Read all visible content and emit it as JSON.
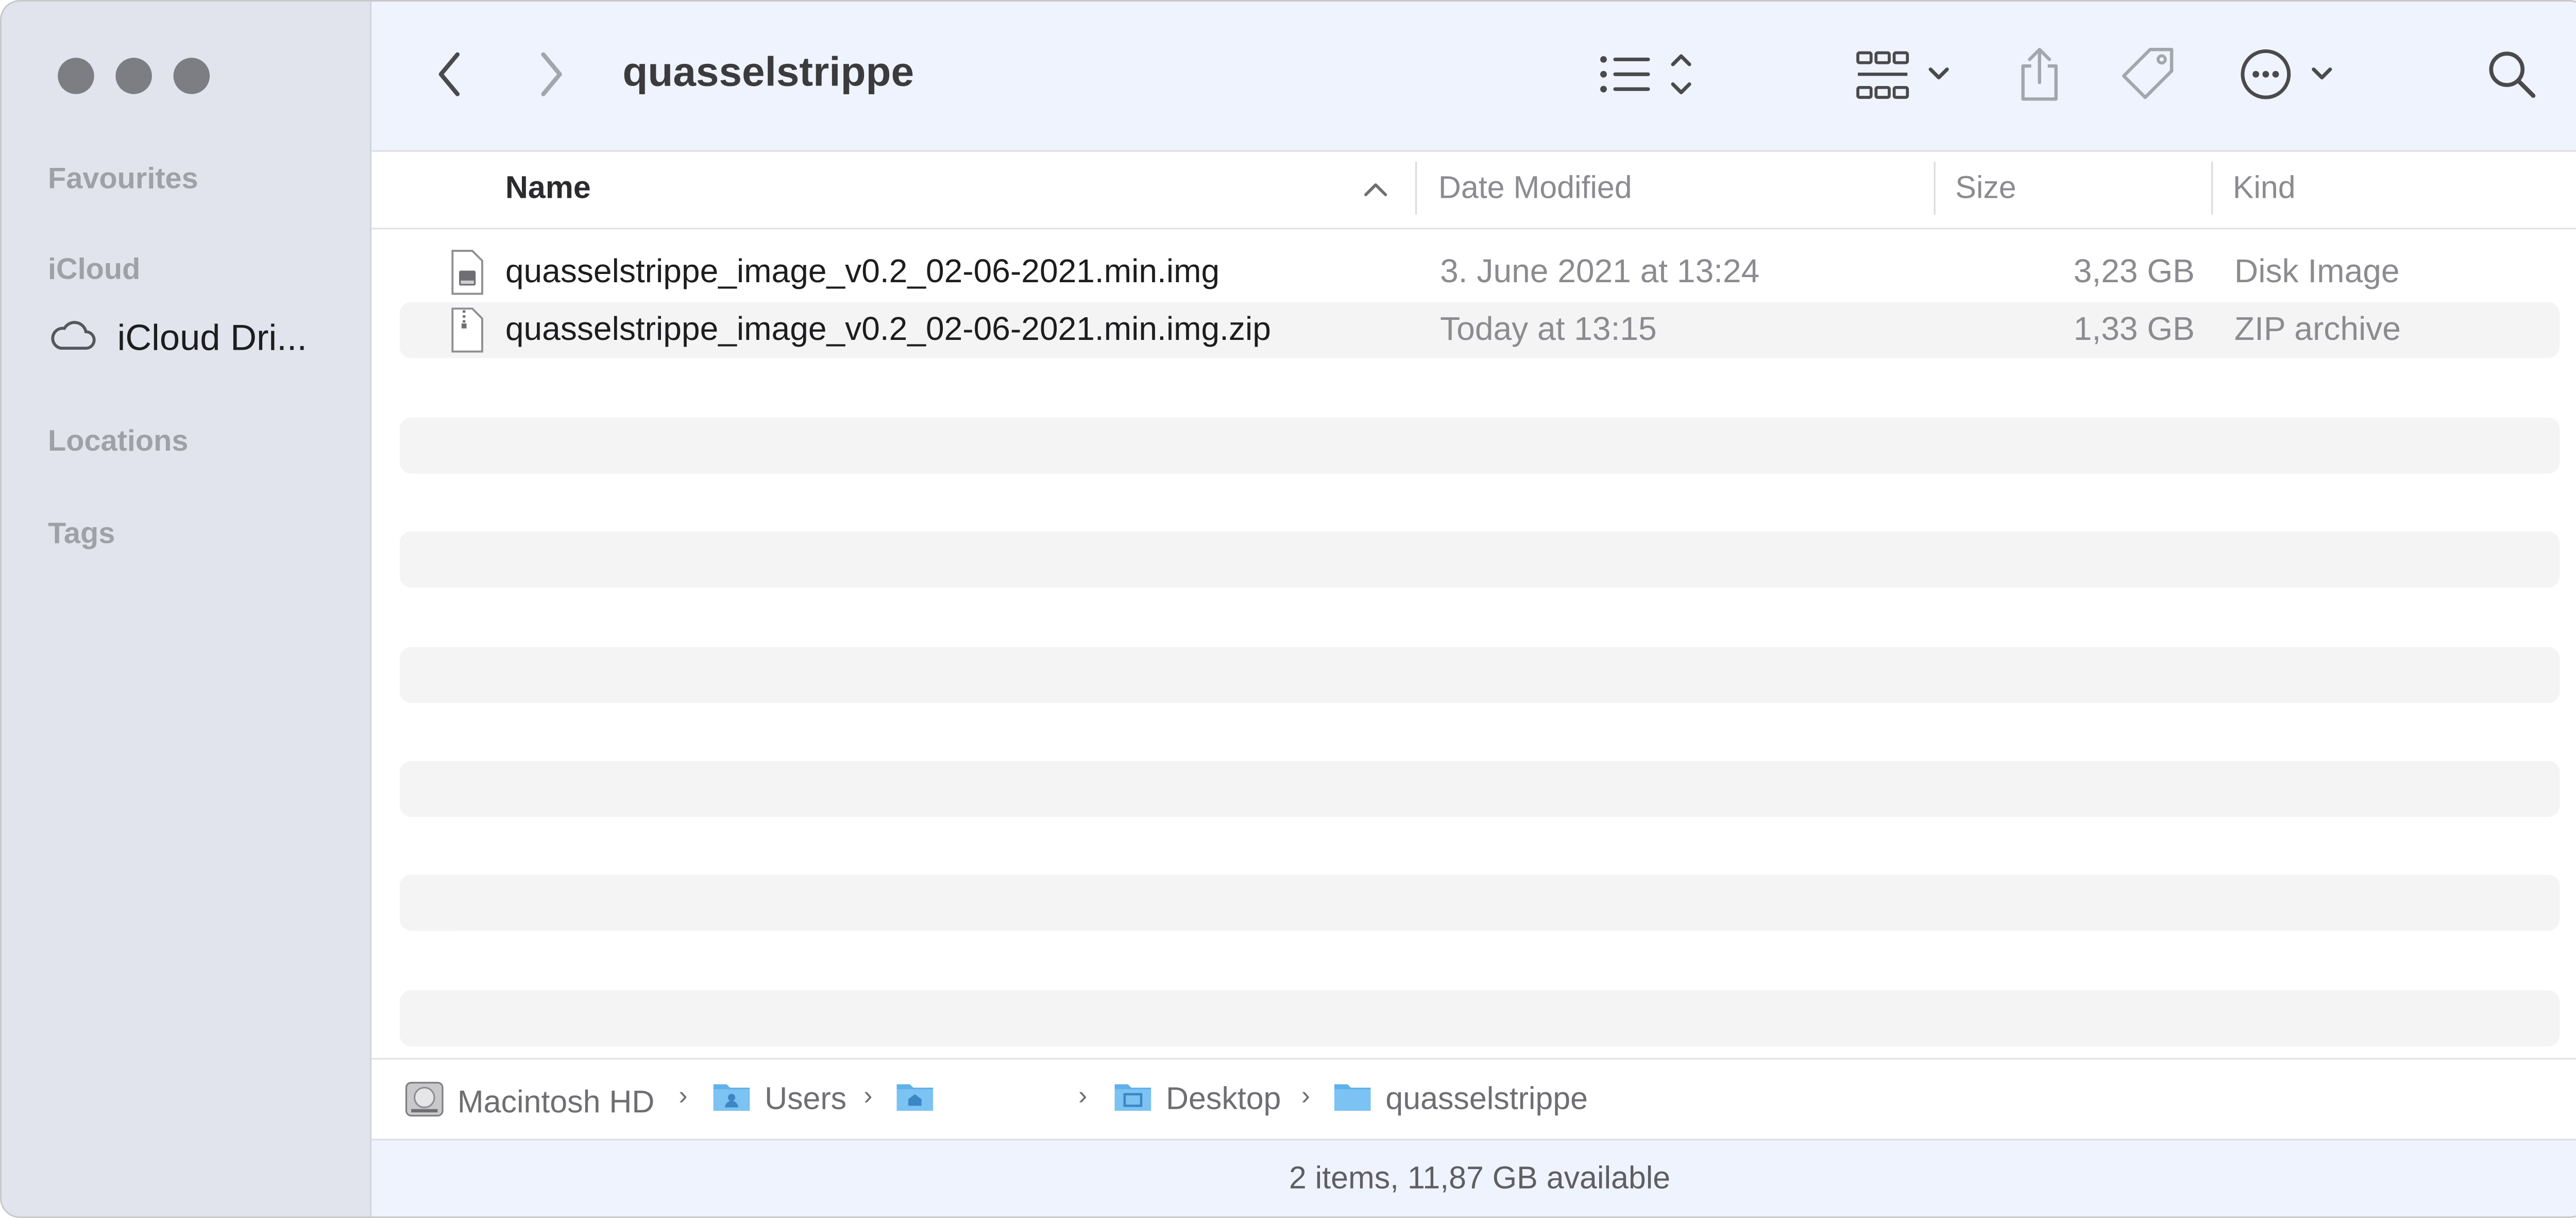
{
  "window": {
    "title": "quasselstrippe"
  },
  "sidebar": {
    "headings": [
      "Favourites",
      "iCloud",
      "Locations",
      "Tags"
    ],
    "items": [
      {
        "label": "iCloud Dri...",
        "icon": "cloud-icon"
      }
    ]
  },
  "toolbar": {
    "icons": [
      "back-icon",
      "forward-icon",
      "list-view-icon",
      "group-icon",
      "share-icon",
      "tag-icon",
      "more-actions-icon",
      "search-icon"
    ]
  },
  "columns": {
    "name": "Name",
    "date": "Date Modified",
    "size": "Size",
    "kind": "Kind",
    "sort": "ascending"
  },
  "files": [
    {
      "name": "quasselstrippe_image_v0.2_02-06-2021.min.img",
      "date": "3. June 2021 at 13:24",
      "size": "3,23 GB",
      "kind": "Disk Image",
      "icon": "disk-image-file-icon"
    },
    {
      "name": "quasselstrippe_image_v0.2_02-06-2021.min.img.zip",
      "date": "Today at 13:15",
      "size": "1,33 GB",
      "kind": "ZIP archive",
      "icon": "zip-file-icon"
    }
  ],
  "pathbar": {
    "crumbs": [
      {
        "label": "Macintosh HD",
        "icon": "hard-drive-icon"
      },
      {
        "label": "Users",
        "icon": "users-folder-icon"
      },
      {
        "label": "",
        "icon": "home-folder-icon"
      },
      {
        "label": "Desktop",
        "icon": "desktop-folder-icon"
      },
      {
        "label": "quasselstrippe",
        "icon": "folder-icon"
      }
    ]
  },
  "status": {
    "text": "2 items, 11,87 GB available"
  },
  "colors": {
    "sidebar_bg": "#e1e4ec",
    "toolbar_bg": "#eff3fd",
    "folder_blue": "#5fb1eb",
    "stripe": "#f4f4f5"
  }
}
